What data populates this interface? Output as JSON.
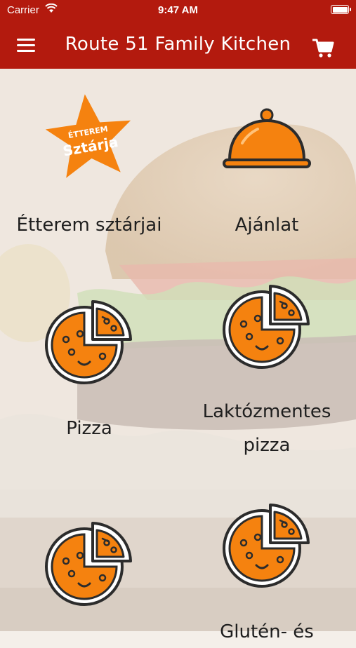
{
  "status_bar": {
    "carrier": "Carrier",
    "time": "9:47 AM"
  },
  "nav": {
    "title": "Route 51 Family Kitchen"
  },
  "badge": {
    "line1": "ÉTTEREM",
    "line2": "Sztárja"
  },
  "colors": {
    "brand_red": "#b31a0e",
    "accent_orange": "#f5820f",
    "icon_outline": "#2c2c2c"
  },
  "grid": {
    "tiles": [
      {
        "label": "Étterem sztárjai",
        "icon": "star-badge-icon"
      },
      {
        "label": "Ajánlat",
        "icon": "cloche-icon"
      },
      {
        "label": "Pizza",
        "icon": "pizza-icon"
      },
      {
        "label_line1": "Laktózmentes",
        "label_line2": "pizza",
        "icon": "pizza-icon"
      },
      {
        "label": "",
        "icon": "pizza-icon"
      },
      {
        "label": "Glutén- és",
        "icon": "pizza-icon"
      }
    ]
  }
}
